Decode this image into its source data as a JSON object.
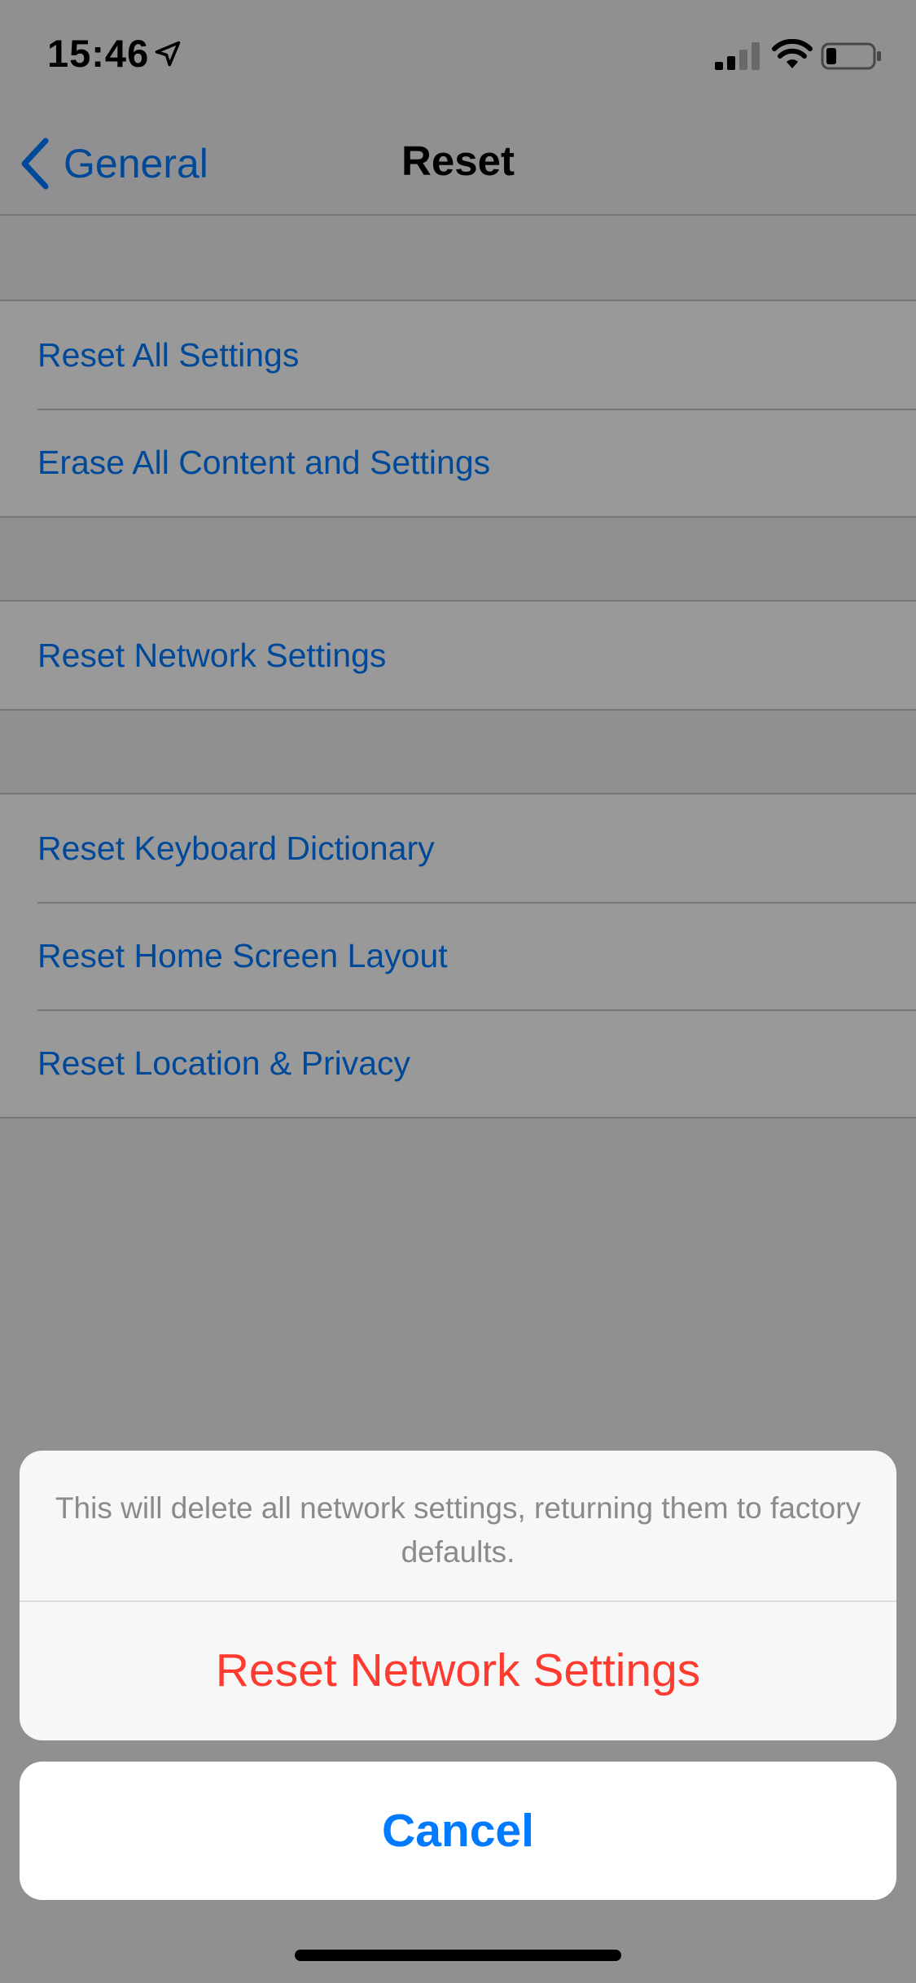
{
  "status_bar": {
    "time": "15:46",
    "icons": [
      "location-arrow-icon",
      "signal-bars-icon",
      "wifi-icon",
      "battery-icon"
    ]
  },
  "nav": {
    "back_label": "General",
    "title": "Reset",
    "back_icon": "chevron-left-icon"
  },
  "groups": [
    {
      "items": [
        {
          "label": "Reset All Settings"
        },
        {
          "label": "Erase All Content and Settings"
        }
      ]
    },
    {
      "items": [
        {
          "label": "Reset Network Settings"
        }
      ]
    },
    {
      "items": [
        {
          "label": "Reset Keyboard Dictionary"
        },
        {
          "label": "Reset Home Screen Layout"
        },
        {
          "label": "Reset Location & Privacy"
        }
      ]
    }
  ],
  "action_sheet": {
    "message": "This will delete all network settings, returning them to factory defaults.",
    "destructive_label": "Reset Network Settings",
    "cancel_label": "Cancel"
  },
  "colors": {
    "accent": "#007aff",
    "destructive": "#ff3b30",
    "background": "#f0f0f3"
  }
}
